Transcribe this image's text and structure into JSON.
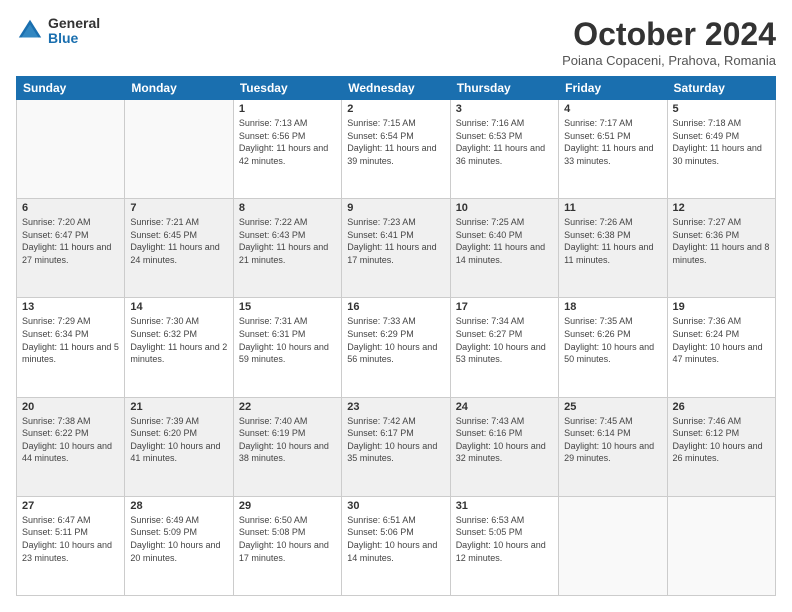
{
  "logo": {
    "general": "General",
    "blue": "Blue"
  },
  "title": "October 2024",
  "location": "Poiana Copaceni, Prahova, Romania",
  "weekdays": [
    "Sunday",
    "Monday",
    "Tuesday",
    "Wednesday",
    "Thursday",
    "Friday",
    "Saturday"
  ],
  "weeks": [
    [
      {
        "day": "",
        "info": ""
      },
      {
        "day": "",
        "info": ""
      },
      {
        "day": "1",
        "info": "Sunrise: 7:13 AM\nSunset: 6:56 PM\nDaylight: 11 hours and 42 minutes."
      },
      {
        "day": "2",
        "info": "Sunrise: 7:15 AM\nSunset: 6:54 PM\nDaylight: 11 hours and 39 minutes."
      },
      {
        "day": "3",
        "info": "Sunrise: 7:16 AM\nSunset: 6:53 PM\nDaylight: 11 hours and 36 minutes."
      },
      {
        "day": "4",
        "info": "Sunrise: 7:17 AM\nSunset: 6:51 PM\nDaylight: 11 hours and 33 minutes."
      },
      {
        "day": "5",
        "info": "Sunrise: 7:18 AM\nSunset: 6:49 PM\nDaylight: 11 hours and 30 minutes."
      }
    ],
    [
      {
        "day": "6",
        "info": "Sunrise: 7:20 AM\nSunset: 6:47 PM\nDaylight: 11 hours and 27 minutes."
      },
      {
        "day": "7",
        "info": "Sunrise: 7:21 AM\nSunset: 6:45 PM\nDaylight: 11 hours and 24 minutes."
      },
      {
        "day": "8",
        "info": "Sunrise: 7:22 AM\nSunset: 6:43 PM\nDaylight: 11 hours and 21 minutes."
      },
      {
        "day": "9",
        "info": "Sunrise: 7:23 AM\nSunset: 6:41 PM\nDaylight: 11 hours and 17 minutes."
      },
      {
        "day": "10",
        "info": "Sunrise: 7:25 AM\nSunset: 6:40 PM\nDaylight: 11 hours and 14 minutes."
      },
      {
        "day": "11",
        "info": "Sunrise: 7:26 AM\nSunset: 6:38 PM\nDaylight: 11 hours and 11 minutes."
      },
      {
        "day": "12",
        "info": "Sunrise: 7:27 AM\nSunset: 6:36 PM\nDaylight: 11 hours and 8 minutes."
      }
    ],
    [
      {
        "day": "13",
        "info": "Sunrise: 7:29 AM\nSunset: 6:34 PM\nDaylight: 11 hours and 5 minutes."
      },
      {
        "day": "14",
        "info": "Sunrise: 7:30 AM\nSunset: 6:32 PM\nDaylight: 11 hours and 2 minutes."
      },
      {
        "day": "15",
        "info": "Sunrise: 7:31 AM\nSunset: 6:31 PM\nDaylight: 10 hours and 59 minutes."
      },
      {
        "day": "16",
        "info": "Sunrise: 7:33 AM\nSunset: 6:29 PM\nDaylight: 10 hours and 56 minutes."
      },
      {
        "day": "17",
        "info": "Sunrise: 7:34 AM\nSunset: 6:27 PM\nDaylight: 10 hours and 53 minutes."
      },
      {
        "day": "18",
        "info": "Sunrise: 7:35 AM\nSunset: 6:26 PM\nDaylight: 10 hours and 50 minutes."
      },
      {
        "day": "19",
        "info": "Sunrise: 7:36 AM\nSunset: 6:24 PM\nDaylight: 10 hours and 47 minutes."
      }
    ],
    [
      {
        "day": "20",
        "info": "Sunrise: 7:38 AM\nSunset: 6:22 PM\nDaylight: 10 hours and 44 minutes."
      },
      {
        "day": "21",
        "info": "Sunrise: 7:39 AM\nSunset: 6:20 PM\nDaylight: 10 hours and 41 minutes."
      },
      {
        "day": "22",
        "info": "Sunrise: 7:40 AM\nSunset: 6:19 PM\nDaylight: 10 hours and 38 minutes."
      },
      {
        "day": "23",
        "info": "Sunrise: 7:42 AM\nSunset: 6:17 PM\nDaylight: 10 hours and 35 minutes."
      },
      {
        "day": "24",
        "info": "Sunrise: 7:43 AM\nSunset: 6:16 PM\nDaylight: 10 hours and 32 minutes."
      },
      {
        "day": "25",
        "info": "Sunrise: 7:45 AM\nSunset: 6:14 PM\nDaylight: 10 hours and 29 minutes."
      },
      {
        "day": "26",
        "info": "Sunrise: 7:46 AM\nSunset: 6:12 PM\nDaylight: 10 hours and 26 minutes."
      }
    ],
    [
      {
        "day": "27",
        "info": "Sunrise: 6:47 AM\nSunset: 5:11 PM\nDaylight: 10 hours and 23 minutes."
      },
      {
        "day": "28",
        "info": "Sunrise: 6:49 AM\nSunset: 5:09 PM\nDaylight: 10 hours and 20 minutes."
      },
      {
        "day": "29",
        "info": "Sunrise: 6:50 AM\nSunset: 5:08 PM\nDaylight: 10 hours and 17 minutes."
      },
      {
        "day": "30",
        "info": "Sunrise: 6:51 AM\nSunset: 5:06 PM\nDaylight: 10 hours and 14 minutes."
      },
      {
        "day": "31",
        "info": "Sunrise: 6:53 AM\nSunset: 5:05 PM\nDaylight: 10 hours and 12 minutes."
      },
      {
        "day": "",
        "info": ""
      },
      {
        "day": "",
        "info": ""
      }
    ]
  ]
}
